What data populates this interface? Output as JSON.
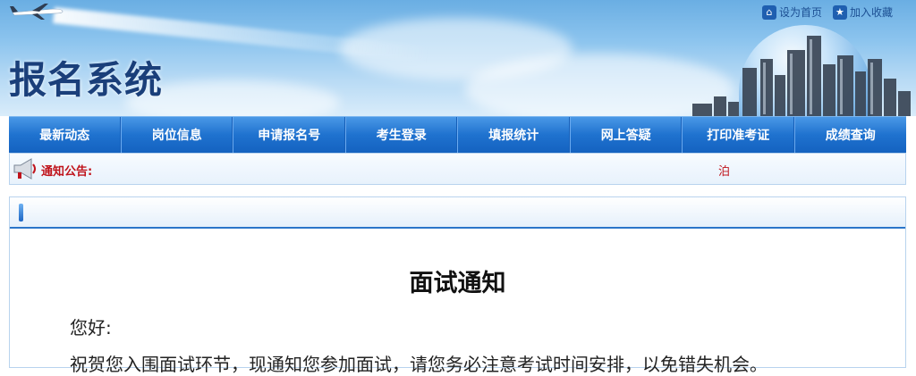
{
  "header": {
    "site_title": "报名系统",
    "links": [
      {
        "label": "设为首页",
        "icon": "home-icon"
      },
      {
        "label": "加入收藏",
        "icon": "star-icon"
      }
    ]
  },
  "nav": {
    "items": [
      {
        "label": "最新动态"
      },
      {
        "label": "岗位信息"
      },
      {
        "label": "申请报名号"
      },
      {
        "label": "考生登录"
      },
      {
        "label": "填报统计"
      },
      {
        "label": "网上答疑"
      },
      {
        "label": "打印准考证"
      },
      {
        "label": "成绩查询"
      }
    ]
  },
  "notice": {
    "label": "通知公告:",
    "scroll_text": "泊"
  },
  "content": {
    "title": "面试通知",
    "greeting": "您好:",
    "body_partial": "祝贺您入围面试环节，现通知您参加面试，请您务必注意考试时间安排，以免错失机会。"
  },
  "colors": {
    "nav_blue": "#1f72cf",
    "title_navy": "#1a3f7a",
    "notice_red": "#c0141c",
    "panel_border": "#b8d3ee"
  }
}
